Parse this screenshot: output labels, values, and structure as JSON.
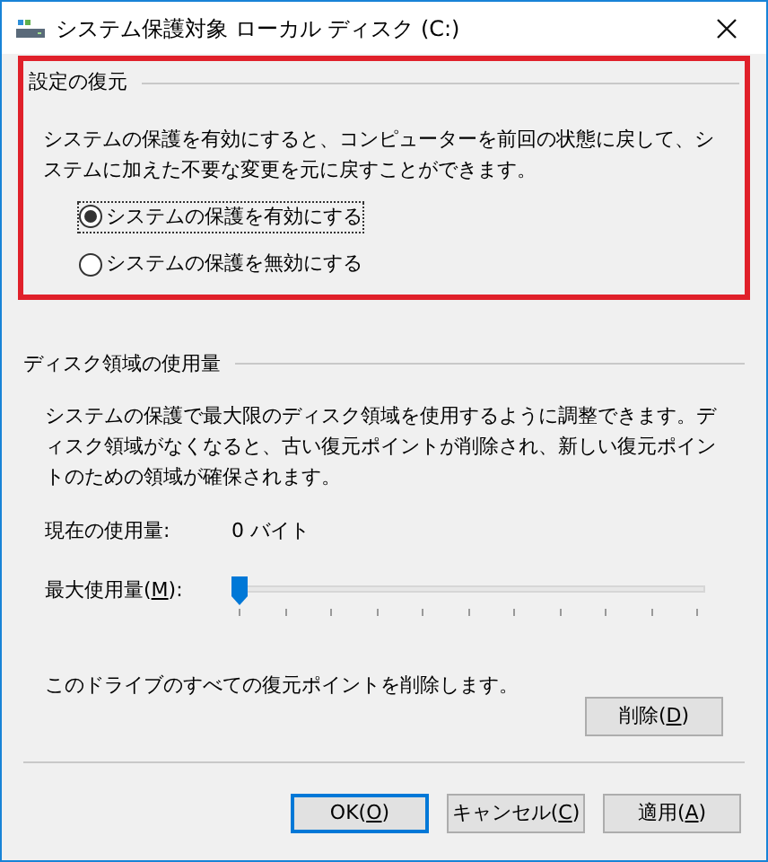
{
  "window": {
    "title": "システム保護対象 ローカル ディスク (C:)"
  },
  "restore_settings": {
    "heading": "設定の復元",
    "description": "システムの保護を有効にすると、コンピューターを前回の状態に戻して、システムに加えた不要な変更を元に戻すことができます。",
    "highlighted": true,
    "options": [
      {
        "label": "システムの保護を有効にする",
        "selected": true
      },
      {
        "label": "システムの保護を無効にする",
        "selected": false
      }
    ]
  },
  "disk_usage": {
    "heading": "ディスク領域の使用量",
    "description": "システムの保護で最大限のディスク領域を使用するように調整できます。ディスク領域がなくなると、古い復元ポイントが削除され、新しい復元ポイントのための領域が確保されます。",
    "current_label": "現在の使用量:",
    "current_value": "0 バイト",
    "max_label": {
      "text": "最大使用量(",
      "key": "M",
      "after": "):"
    },
    "max_slider": {
      "level": 0
    }
  },
  "delete": {
    "description": "このドライブのすべての復元ポイントを削除します。",
    "button": {
      "text": "削除(",
      "key": "D",
      "after": ")"
    }
  },
  "buttons": [
    {
      "text": "OK(",
      "key": "O",
      "after": ")",
      "default": true
    },
    {
      "text": "キャンセル(",
      "key": "C",
      "after": ")",
      "default": false
    },
    {
      "text": "適用(",
      "key": "A",
      "after": ")",
      "default": false
    }
  ]
}
